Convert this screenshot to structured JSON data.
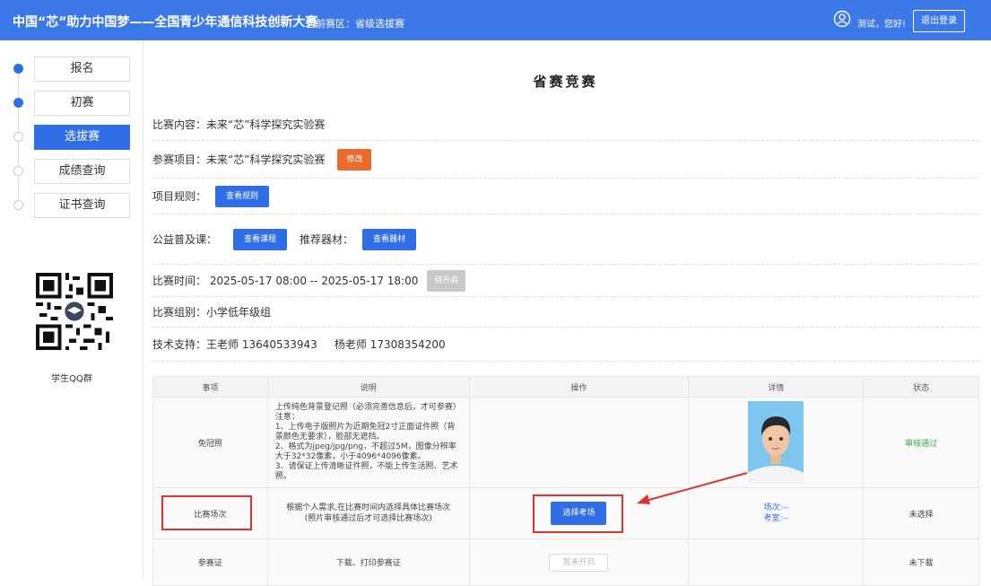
{
  "header": {
    "title": "中国“芯”助力中国梦——全国青少年通信科技创新大赛",
    "region": "当前赛区：省级选拔赛",
    "greeting": "测试，您好!",
    "logout": "退出登录",
    "bg_color": "#3d78e8"
  },
  "sidebar": {
    "steps": [
      {
        "label": "报名",
        "done": true
      },
      {
        "label": "初赛",
        "done": true
      },
      {
        "label": "选拔赛",
        "current": true
      },
      {
        "label": "成绩查询"
      },
      {
        "label": "证书查询"
      }
    ],
    "qr_label": "学生QQ群"
  },
  "main": {
    "title": "省赛竞赛",
    "content": "比赛内容：未来“芯”科学探究实验赛",
    "project": "参赛项目：未来“芯”科学探究实验赛",
    "modify": "修改",
    "rules_label": "项目规则：",
    "view_rules": "查看规则",
    "welfare_label": "公益普及课：",
    "view_course": "查看课程",
    "equipment_label": "推荐器材：",
    "view_equipment": "查看器材",
    "time": "比赛时间：  2025-05-17 08:00 -- 2025-05-17 18:00",
    "not_started": "待开启",
    "group": "比赛组别：小学低年级组",
    "support": "技术支持：王老师 13640533943     杨老师 17308354200"
  },
  "table": {
    "headers": [
      "事项",
      "说明",
      "操作",
      "详情",
      "状态"
    ],
    "row1": {
      "item": "免冠照",
      "desc": [
        "上传纯色背景登记照（必须完善信息后，才可参赛）",
        "注意：",
        "1、上传电子版照片为近期免冠2寸正面证件照（背景颜色无要求），脸部无遮挡。",
        "2、格式为jpeg/jpg/png，不超过5M，图像分辨率大于32*32像素，小于4096*4096像素。",
        "3、请保证上传清晰证件照，不能上传生活照、艺术照。"
      ],
      "status": "审核通过"
    },
    "row2": {
      "item": "比赛场次",
      "desc1": "根据个人需求,在比赛时间内选择具体比赛场次",
      "desc2": "(照片审核通过后才可选择比赛场次)",
      "action": "选择考场",
      "detail1": "场次:--",
      "detail2": "考室:--",
      "status": "未选择"
    },
    "row3": {
      "item": "参赛证",
      "desc": "下载、打印参赛证",
      "action": "暂未开启",
      "status": "未下载"
    }
  }
}
